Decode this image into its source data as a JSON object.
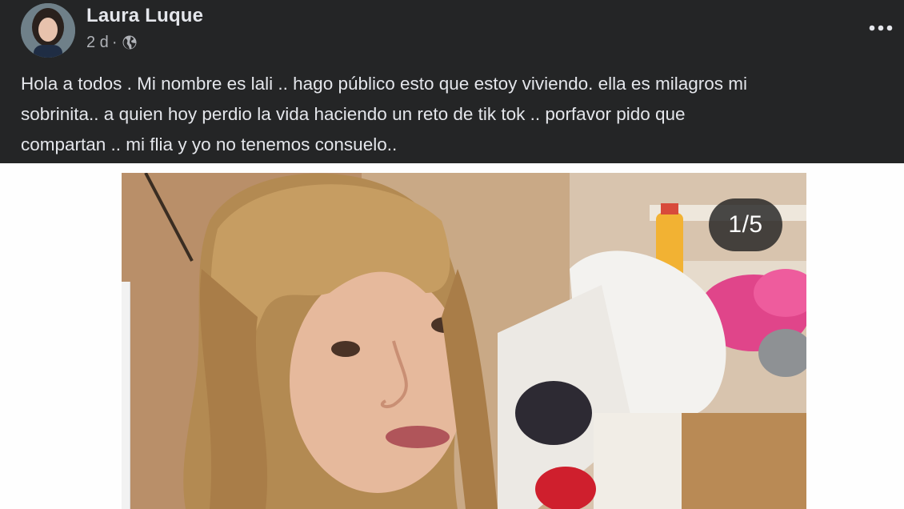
{
  "post": {
    "author": "Laura Luque",
    "time": "2 d",
    "separator": "·",
    "privacy_icon": "globe-icon",
    "more_icon": "more-horizontal-icon",
    "text": "Hola a todos . Mi nombre es lali .. hago público  esto que estoy viviendo.  ella es milagros mi\nsobrinita.. a quien hoy perdio la vida haciendo un reto de tik tok .. porfavor pido que\ncompartan .. mi flia y yo no tenemos consuelo.."
  },
  "photo": {
    "counter": "1/5"
  },
  "colors": {
    "header_bg": "#242526",
    "text_primary": "#e4e6eb",
    "text_secondary": "#b0b3b8",
    "page_bg": "#fefefe"
  }
}
